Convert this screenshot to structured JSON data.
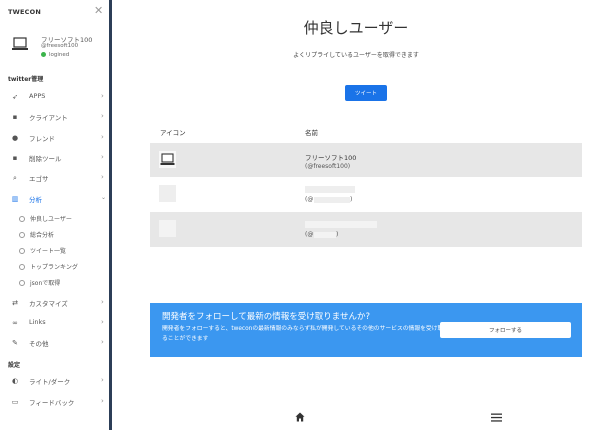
{
  "brand": "TWECON",
  "profile": {
    "name": "フリーソフト100",
    "handle": "@freesoft100",
    "status": "logined"
  },
  "sidebar": {
    "section_twitter": "twitter管理",
    "items": [
      {
        "label": "APPS",
        "icon": "rocket-icon"
      },
      {
        "label": "クライアント",
        "icon": "trash-icon"
      },
      {
        "label": "フレンド",
        "icon": "users-icon"
      },
      {
        "label": "削除ツール",
        "icon": "trash-icon"
      },
      {
        "label": "エゴサ",
        "icon": "search-icon"
      },
      {
        "label": "分析",
        "icon": "chart-icon"
      }
    ],
    "analysis_subitems": [
      "仲良しユーザー",
      "総合分析",
      "ツイート一覧",
      "トップランキング",
      "jsonで取得"
    ],
    "items2": [
      {
        "label": "カスタマイズ",
        "icon": "arrows-icon"
      },
      {
        "label": "Links",
        "icon": "link-icon"
      },
      {
        "label": "その他",
        "icon": "pen-icon"
      }
    ],
    "section_settings": "設定",
    "items3": [
      {
        "label": "ライト/ダーク",
        "icon": "contrast-icon"
      },
      {
        "label": "フィードバック",
        "icon": "comment-icon"
      }
    ]
  },
  "main": {
    "title": "仲良しユーザー",
    "subtitle": "よくリプライしているユーザーを取得できます",
    "tweet_button": "ツイート",
    "table": {
      "headers": [
        "アイコン",
        "名前"
      ],
      "rows": [
        {
          "name": "フリーソフト100",
          "handle": "(@freesoft100)"
        },
        {
          "handle_prefix": "(@",
          "handle_suffix": ")"
        },
        {
          "handle_prefix": "(@",
          "handle_suffix": ")"
        }
      ]
    },
    "banner": {
      "title": "開発者をフォローして最新の情報を受け取りませんか?",
      "text": "開発者をフォローすると、tweconの最新情報のみならず私が開発しているその他のサービスの情報を受け取ることができます",
      "button": "フォローする"
    }
  },
  "colors": {
    "accent": "#1a73e8",
    "banner": "#3b97f0",
    "sidebar_edge": "#2c3e57",
    "row_bg": "#e7e7e7"
  }
}
